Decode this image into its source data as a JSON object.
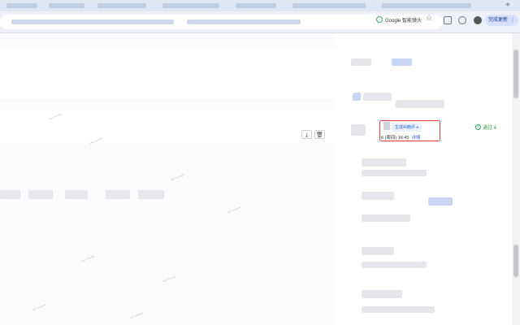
{
  "browser": {
    "lens_label": "Google 智能镜头",
    "update_label": "完成更新"
  },
  "record": {
    "ai_button_label": "生成AI摘评",
    "ai_arrow": "▸",
    "time": "6 (周四) 16:45",
    "detail_link": "详情",
    "status_text": "通过 4"
  },
  "icons": {
    "download": "⤓",
    "delete": "🗑"
  }
}
